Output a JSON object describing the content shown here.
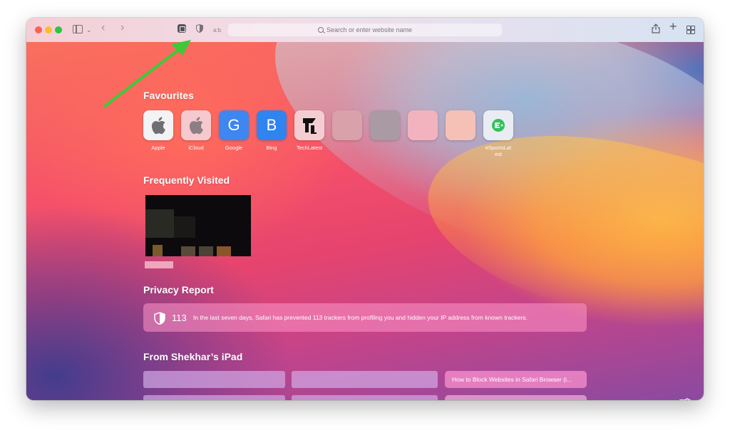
{
  "toolbar": {
    "reader_label": "a:b",
    "address_placeholder": "Search or enter website name"
  },
  "favourites": {
    "title": "Favourites",
    "items": [
      {
        "label": "Apple",
        "glyph": ""
      },
      {
        "label": "iCloud",
        "glyph": ""
      },
      {
        "label": "Google",
        "glyph": "G"
      },
      {
        "label": "Bing",
        "glyph": "B"
      },
      {
        "label": "TechLatest",
        "glyph": ""
      },
      {
        "label": "",
        "glyph": ""
      },
      {
        "label": "",
        "glyph": ""
      },
      {
        "label": "",
        "glyph": ""
      },
      {
        "label": "",
        "glyph": ""
      },
      {
        "label": "eSportsLat est",
        "glyph": ""
      }
    ]
  },
  "frequently_visited": {
    "title": "Frequently Visited"
  },
  "privacy_report": {
    "title": "Privacy Report",
    "count": "113",
    "message": "In the last seven days, Safari has prevented 113 trackers from profiling you and hidden your IP address from known trackers."
  },
  "ipad": {
    "title": "From Shekhar’s iPad",
    "tab_label": "How to Block Websites in Safari Browser (i..."
  },
  "colors": {
    "arrow": "#3fc93a",
    "traffic_red": "#fe5f57",
    "traffic_yellow": "#febc2e",
    "traffic_green": "#28c840"
  }
}
